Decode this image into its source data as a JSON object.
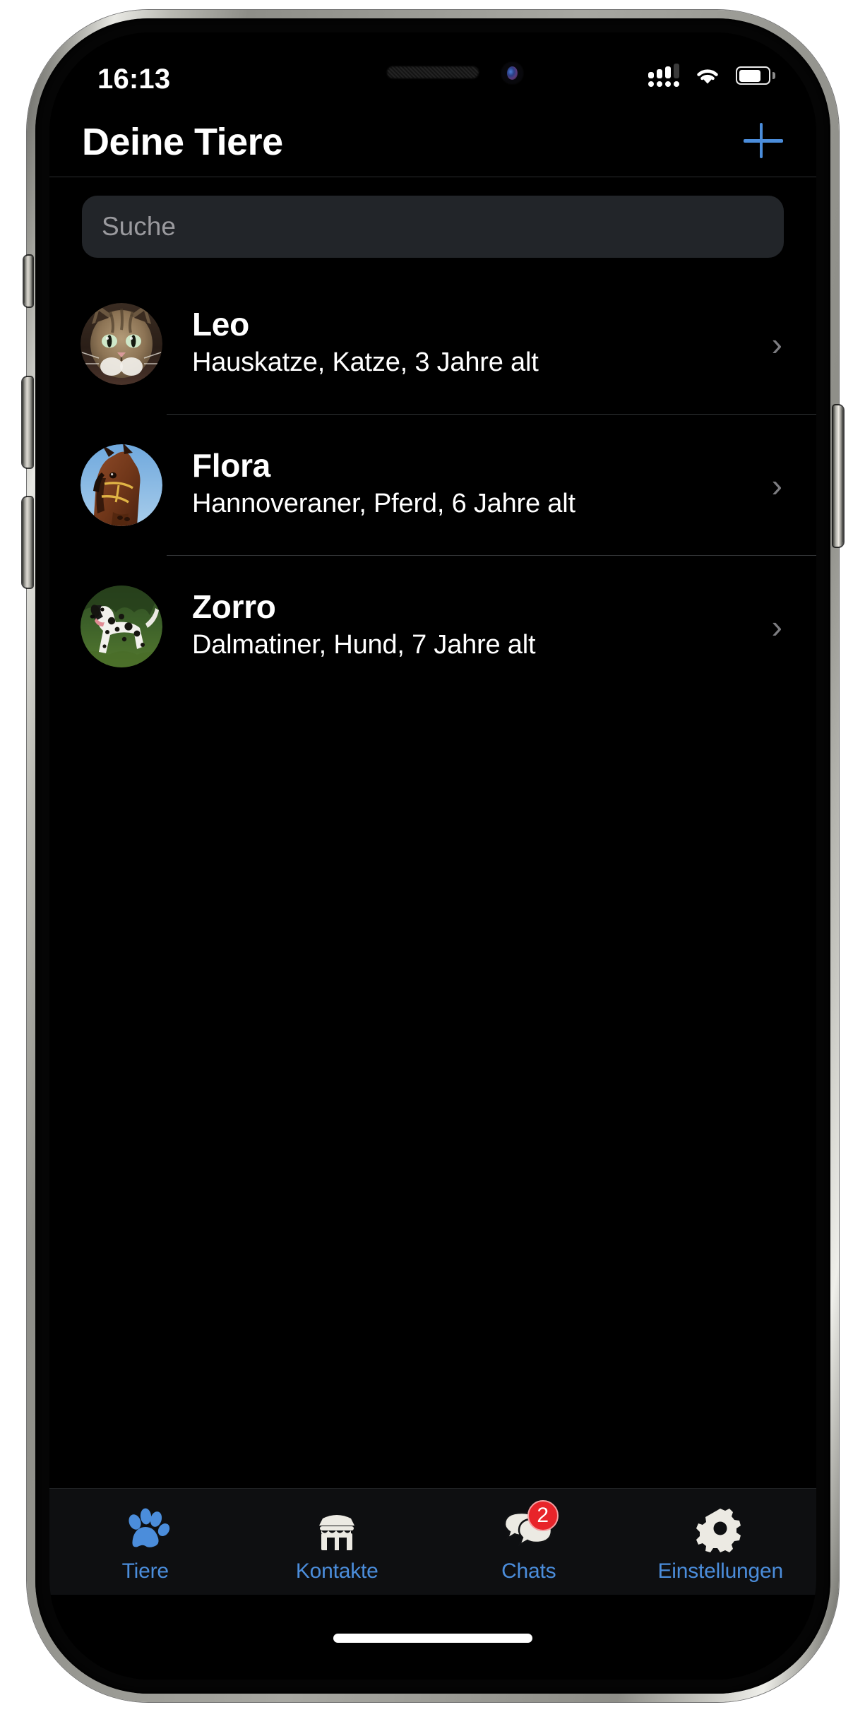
{
  "status_bar": {
    "time": "16:13",
    "cellular_icon": "cellular-signal-icon",
    "cellular_bars_active": 3,
    "cellular_bars_total": 4,
    "wifi_icon": "wifi-icon",
    "battery_icon": "battery-icon",
    "battery_level_percent": 75
  },
  "nav": {
    "title": "Deine Tiere",
    "add_icon": "plus-icon"
  },
  "search": {
    "placeholder": "Suche",
    "value": ""
  },
  "pets": [
    {
      "name": "Leo",
      "detail": "Hauskatze, Katze, 3 Jahre alt",
      "avatar": "tabby-cat-photo",
      "chevron": "›"
    },
    {
      "name": "Flora",
      "detail": "Hannoveraner, Pferd, 6 Jahre alt",
      "avatar": "bay-horse-photo",
      "chevron": "›"
    },
    {
      "name": "Zorro",
      "detail": "Dalmatiner, Hund, 7 Jahre alt",
      "avatar": "dalmatian-dog-photo",
      "chevron": "›"
    }
  ],
  "tabs": [
    {
      "label": "Tiere",
      "icon": "paw-icon",
      "active": true,
      "badge": ""
    },
    {
      "label": "Kontakte",
      "icon": "storefront-icon",
      "active": false,
      "badge": ""
    },
    {
      "label": "Chats",
      "icon": "chat-bubbles-icon",
      "active": false,
      "badge": "2"
    },
    {
      "label": "Einstellungen",
      "icon": "gear-icon",
      "active": false,
      "badge": ""
    }
  ],
  "colors": {
    "accent_blue": "#4b8ddb",
    "badge_red": "#e8242a",
    "screen_background": "#000000",
    "tab_bar_background": "#0e0f11",
    "search_field_background": "#222529"
  }
}
